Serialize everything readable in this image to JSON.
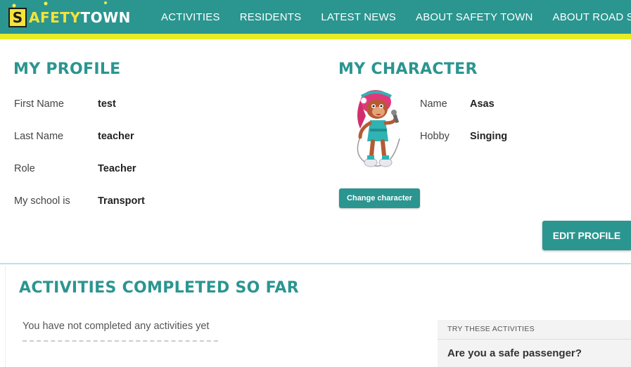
{
  "header": {
    "logo": {
      "letter": "S",
      "part1": "AFETY",
      "part2": "TOWN"
    },
    "nav": [
      "ACTIVITIES",
      "RESIDENTS",
      "LATEST NEWS",
      "ABOUT SAFETY TOWN",
      "ABOUT ROAD SAFET"
    ]
  },
  "profile": {
    "title": "MY PROFILE",
    "fields": [
      {
        "label": "First Name",
        "value": "test"
      },
      {
        "label": "Last Name",
        "value": "teacher"
      },
      {
        "label": "Role",
        "value": "Teacher"
      },
      {
        "label": "My school is",
        "value": "Transport"
      }
    ]
  },
  "character": {
    "title": "MY CHARACTER",
    "fields": [
      {
        "label": "Name",
        "value": "Asas"
      },
      {
        "label": "Hobby",
        "value": "Singing"
      }
    ],
    "change_button": "Change character"
  },
  "edit_profile_button": "EDIT PROFILE",
  "activities": {
    "title": "ACTIVITIES COMPLETED SO FAR",
    "empty_message": "You have not completed any activities yet",
    "try_panel": {
      "title": "TRY THESE ACTIVITIES",
      "items": [
        "Are you a safe passenger?"
      ]
    }
  },
  "colors": {
    "brand_teal": "#2b9590",
    "accent_yellow": "#e7ec24"
  }
}
